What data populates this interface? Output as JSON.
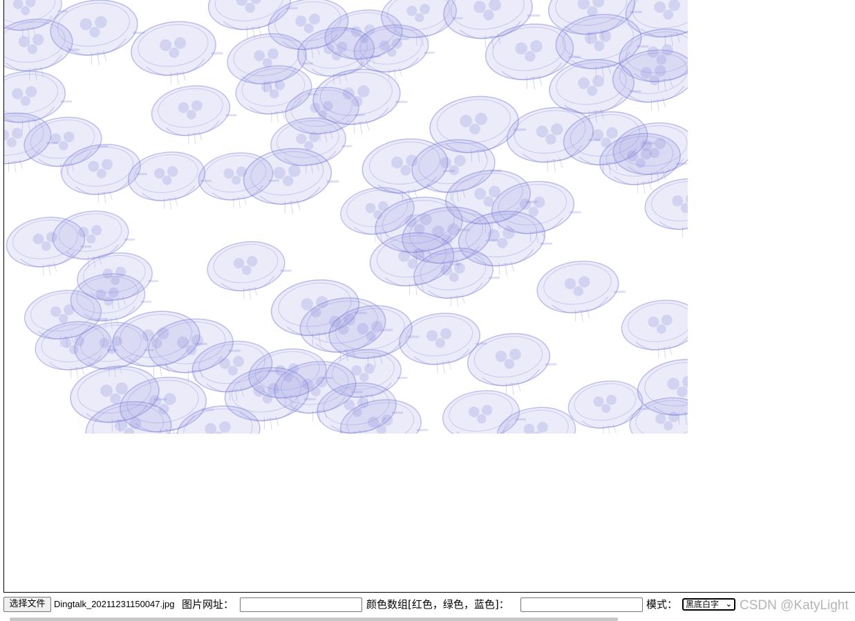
{
  "canvas": {
    "image_alt": "jellyfish pattern",
    "tint_color": "#7b7dd8"
  },
  "toolbar": {
    "file_button_label": "选择文件",
    "file_name": "Dingtalk_20211231150047.jpg",
    "url_label": "图片网址：",
    "url_value": "",
    "color_label": "颜色数组[红色，绿色，蓝色]：",
    "color_value": "",
    "mode_label": "模式：",
    "mode_selected": "黑底白字",
    "mode_chevron": "chevron-down-icon"
  },
  "watermark": "CSDN @KatyLight"
}
